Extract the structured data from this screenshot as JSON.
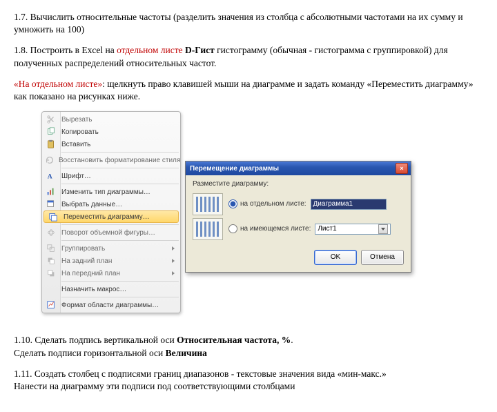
{
  "para17": "1.7. Вычислить относительные частоты (разделить значения из столбца с абсолютными частотами на их сумму и умножить на 100)",
  "para18_a": "1.8. Построить  в Excel на ",
  "para18_red": "отдельном листе ",
  "para18_bold": "D-Гист",
  "para18_b": " гистограмму (обычная - гистограмма с группировкой) для полученных распределений относительных частот.",
  "noteA": "«На отдельном листе»",
  "noteB": ": щелкнуть право клавишей мыши на диаграмме и задать команду «Переместить диаграмму» как  показано на рисунках ниже.",
  "menu": {
    "cut": "Вырезать",
    "copy": "Копировать",
    "paste": "Вставить",
    "resetStyle": "Восстановить форматирование стиля",
    "font": "Шрифт…",
    "changeType": "Изменить тип диаграммы…",
    "selectData": "Выбрать данные…",
    "moveChart": "Переместить диаграмму…",
    "rotate3d": "Поворот объемной фигуры…",
    "group": "Группировать",
    "toBack": "На задний план",
    "toFront": "На передний план",
    "assignMacro": "Назначить макрос…",
    "formatArea": "Формат области диаграммы…"
  },
  "dlg": {
    "title": "Перемещение диаграммы",
    "heading": "Разместите диаграмму:",
    "opt1": "на отдельном листе:",
    "opt1val": "Диаграмма1",
    "opt2": "на имеющемся листе:",
    "opt2val": "Лист1",
    "ok": "OK",
    "cancel": "Отмена"
  },
  "para110a": "1.10. Сделать подпись вертикальной оси ",
  "para110b": "Относительная частота, %",
  "para110c": ".",
  "para110d": "Сделать подписи горизонтальной оси ",
  "para110e": "Величина",
  "para111a": "1.11. Создать столбец с подписями границ диапазонов - текстовые значения вида «мин-макс.»",
  "para111b": "Нанести на диаграмму эти подписи под соответствующими столбцами"
}
